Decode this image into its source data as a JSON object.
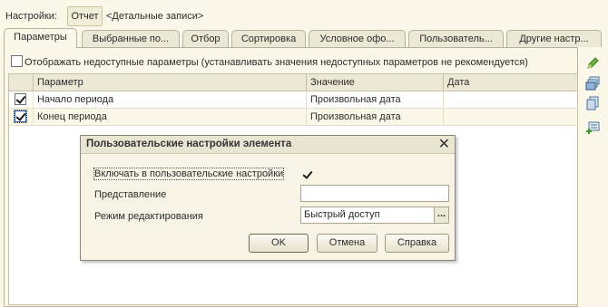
{
  "topbar": {
    "label": "Настройки:",
    "report_button": "Отчет",
    "variant": "<Детальные записи>"
  },
  "tabs": [
    {
      "label": "Параметры"
    },
    {
      "label": "Выбранные по..."
    },
    {
      "label": "Отбор"
    },
    {
      "label": "Сортировка"
    },
    {
      "label": "Условное офо..."
    },
    {
      "label": "Пользователь..."
    },
    {
      "label": "Другие настр..."
    }
  ],
  "show_unavailable": {
    "label": "Отображать недоступные параметры (устанавливать значения недоступных параметров не рекомендуется)",
    "checked": false
  },
  "grid": {
    "columns": [
      "Параметр",
      "Значение",
      "Дата"
    ],
    "rows": [
      {
        "checked": true,
        "param": "Начало периода",
        "value": "Произвольная дата",
        "date": ""
      },
      {
        "checked": true,
        "param": "Конец периода",
        "value": "Произвольная дата",
        "date": ""
      }
    ]
  },
  "sidebar_icons": [
    "pencil-icon",
    "layers-icon",
    "copy-icon",
    "add-settings-icon"
  ],
  "dialog": {
    "title": "Пользовательские настройки элемента",
    "include_label": "Включать в пользовательские настройки",
    "include_checked": true,
    "presentation_label": "Представление",
    "presentation_value": "",
    "edit_mode_label": "Режим редактирования",
    "edit_mode_value": "Быстрый доступ",
    "ok_label": "OK",
    "cancel_label": "Отмена",
    "help_label": "Справка"
  }
}
